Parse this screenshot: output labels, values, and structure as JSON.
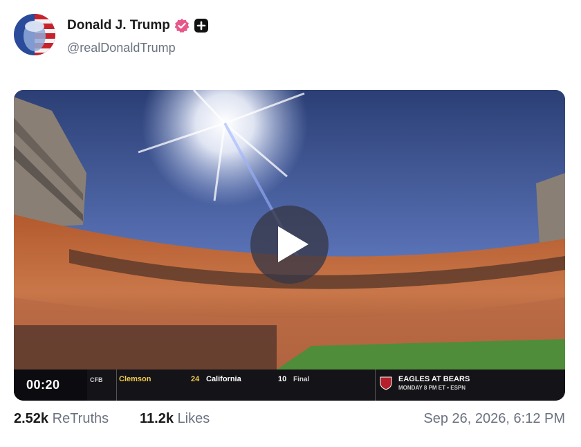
{
  "post": {
    "display_name": "Donald J. Trump",
    "handle": "@realDonaldTrump",
    "verified_icon": "verified-badge-icon",
    "follow_icon": "plus-icon",
    "colors": {
      "verified": "#e8578a",
      "text": "#1a1a1a",
      "muted": "#6b7280"
    }
  },
  "video": {
    "timer": "00:20",
    "ticker": {
      "league": "CFB",
      "team1": "Clemson",
      "score1": "24",
      "team2": "California",
      "score2": "10",
      "status": "Final",
      "promo_title": "EAGLES AT BEARS",
      "promo_sub": "MONDAY 8 PM ET • ESPN"
    }
  },
  "stats": {
    "retruths_count": "2.52k",
    "retruths_label": "ReTruths",
    "likes_count": "11.2k",
    "likes_label": "Likes",
    "timestamp": "Sep 26, 2026, 6:12 PM"
  }
}
